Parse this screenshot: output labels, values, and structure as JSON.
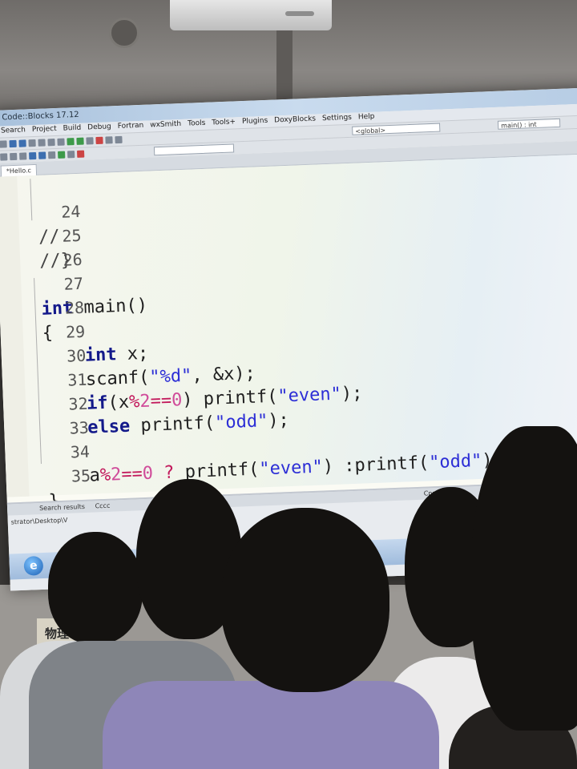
{
  "ide": {
    "title": "Code::Blocks 17.12",
    "menu": [
      "Search",
      "Project",
      "Build",
      "Debug",
      "Fortran",
      "wxSmith",
      "Tools",
      "Tools+",
      "Plugins",
      "DoxyBlocks",
      "Settings",
      "Help"
    ],
    "toolbar_scope": "<global>",
    "toolbar_function": "main() : int",
    "file_tab": "*Hello.c",
    "code_lines": [
      {
        "num": "24",
        "text": "//"
      },
      {
        "num": "25",
        "text": "//}"
      },
      {
        "num": "26",
        "text": ""
      },
      {
        "num": "27",
        "text": "int main()"
      },
      {
        "num": "28",
        "text": "{"
      },
      {
        "num": "29",
        "text": "int x;"
      },
      {
        "num": "30",
        "text": "scanf(\"%d\", &x);"
      },
      {
        "num": "31",
        "text": "if(x%2==0) printf(\"even\");"
      },
      {
        "num": "32",
        "text": "else printf(\"odd\");"
      },
      {
        "num": "33",
        "text": ""
      },
      {
        "num": "34",
        "text": "a%2==0 ? printf(\"even\") :printf(\"odd\");"
      },
      {
        "num": "35",
        "text": "}"
      }
    ],
    "bottom_tab": "Search results",
    "bottom_tab2": "Cccc",
    "bottom_path": "strator\\Desktop\\V",
    "right_tab": "Cpp"
  },
  "wall_sign": "物理"
}
